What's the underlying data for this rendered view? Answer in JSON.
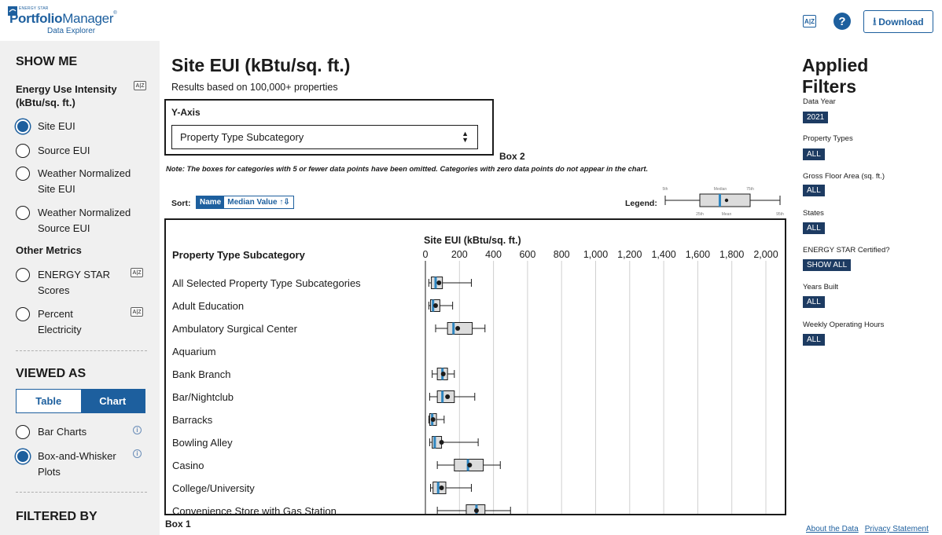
{
  "header": {
    "logo_small": "ENERGY STAR",
    "logo_bold": "Portfolio",
    "logo_light": "Manager",
    "logo_reg": "®",
    "logo_sub": "Data Explorer",
    "az_label": "A|Z",
    "help_label": "?",
    "download_label": "Download",
    "download_icon": "download-icon"
  },
  "sidebar": {
    "show_me": "SHOW ME",
    "eui_heading": "Energy Use Intensity (kBtu/sq. ft.)",
    "az_label": "A|Z",
    "eui_options": [
      {
        "label": "Site EUI",
        "checked": true
      },
      {
        "label": "Source EUI",
        "checked": false
      },
      {
        "label": "Weather Normalized Site EUI",
        "checked": false
      },
      {
        "label": "Weather Normalized Source EUI",
        "checked": false
      }
    ],
    "other_metrics": "Other Metrics",
    "other_options": [
      {
        "label": "ENERGY STAR Scores",
        "checked": false
      },
      {
        "label": "Percent Electricity",
        "checked": false
      }
    ],
    "viewed_as": "VIEWED AS",
    "view_table": "Table",
    "view_chart": "Chart",
    "chart_options": [
      {
        "label": "Bar Charts",
        "checked": false
      },
      {
        "label": "Box-and-Whisker Plots",
        "checked": true
      }
    ],
    "info_glyph": "i",
    "filtered_by": "FILTERED BY"
  },
  "main": {
    "title": "Site EUI (kBtu/sq. ft.)",
    "subtitle": "Results based on 100,000+ properties",
    "yaxis_label": "Y-Axis",
    "yaxis_value": "Property Type Subcategory",
    "box2_label": "Box 2",
    "note": "Note: The boxes for categories with 5 or fewer data points have been omitted. Categories with zero data points do not appear in the chart.",
    "sort_label": "Sort:",
    "sort_name": "Name",
    "sort_median": "Median Value ↑⇩",
    "legend_label": "Legend:",
    "box1_label": "Box 1"
  },
  "legend": {
    "labels": {
      "p5": "5th",
      "median": "Median",
      "p75": "75th",
      "p25": "25th",
      "mean": "Mean",
      "p95": "95th"
    }
  },
  "chart_data": {
    "type": "box",
    "title": "Site EUI (kBtu/sq. ft.)",
    "ylabel": "Property Type Subcategory",
    "xlim": [
      0,
      2000
    ],
    "xticks": [
      "0",
      "200",
      "400",
      "600",
      "800",
      "1,000",
      "1,200",
      "1,400",
      "1,600",
      "1,800",
      "2,000"
    ],
    "tick_values": [
      0,
      200,
      400,
      600,
      800,
      1000,
      1200,
      1400,
      1600,
      1800,
      2000
    ],
    "categories": [
      {
        "name": "All Selected Property Type Subcategories",
        "p5": 20,
        "p25": 35,
        "median": 60,
        "p75": 100,
        "p95": 270,
        "mean": 80
      },
      {
        "name": "Adult Education",
        "p5": 20,
        "p25": 30,
        "median": 45,
        "p75": 85,
        "p95": 160,
        "mean": 60
      },
      {
        "name": "Ambulatory Surgical Center",
        "p5": 60,
        "p25": 130,
        "median": 165,
        "p75": 275,
        "p95": 350,
        "mean": 190
      },
      {
        "name": "Aquarium"
      },
      {
        "name": "Bank Branch",
        "p5": 40,
        "p25": 70,
        "median": 100,
        "p75": 130,
        "p95": 170,
        "mean": 105
      },
      {
        "name": "Bar/Nightclub",
        "p5": 25,
        "p25": 70,
        "median": 100,
        "p75": 170,
        "p95": 290,
        "mean": 130
      },
      {
        "name": "Barracks",
        "p5": 20,
        "p25": 25,
        "median": 40,
        "p75": 65,
        "p95": 110,
        "mean": 45
      },
      {
        "name": "Bowling Alley",
        "p5": 25,
        "p25": 40,
        "median": 55,
        "p75": 95,
        "p95": 310,
        "mean": 95
      },
      {
        "name": "Casino",
        "p5": 70,
        "p25": 170,
        "median": 250,
        "p75": 340,
        "p95": 440,
        "mean": 260
      },
      {
        "name": "College/University",
        "p5": 30,
        "p25": 45,
        "median": 75,
        "p75": 120,
        "p95": 270,
        "mean": 95
      },
      {
        "name": "Convenience Store with Gas Station",
        "p5": 70,
        "p25": 240,
        "median": 300,
        "p75": 350,
        "p95": 500,
        "mean": 300
      }
    ]
  },
  "filters": {
    "title": "Applied Filters",
    "items": [
      {
        "label": "Data Year",
        "chip": "2021"
      },
      {
        "label": "Property Types",
        "chip": "ALL"
      },
      {
        "label": "Gross Floor Area (sq. ft.)",
        "chip": "ALL"
      },
      {
        "label": "States",
        "chip": "ALL"
      },
      {
        "label": "ENERGY STAR Certified?",
        "chip": "SHOW ALL"
      },
      {
        "label": "Years Built",
        "chip": "ALL"
      },
      {
        "label": "Weekly Operating Hours",
        "chip": "ALL"
      }
    ]
  },
  "footer": {
    "about": "About the Data",
    "privacy": "Privacy Statement"
  },
  "colors": {
    "brand": "#1d5f9e",
    "chip": "#1d3b62",
    "median": "#2e86c1",
    "box_fill": "#dcdcdc"
  }
}
